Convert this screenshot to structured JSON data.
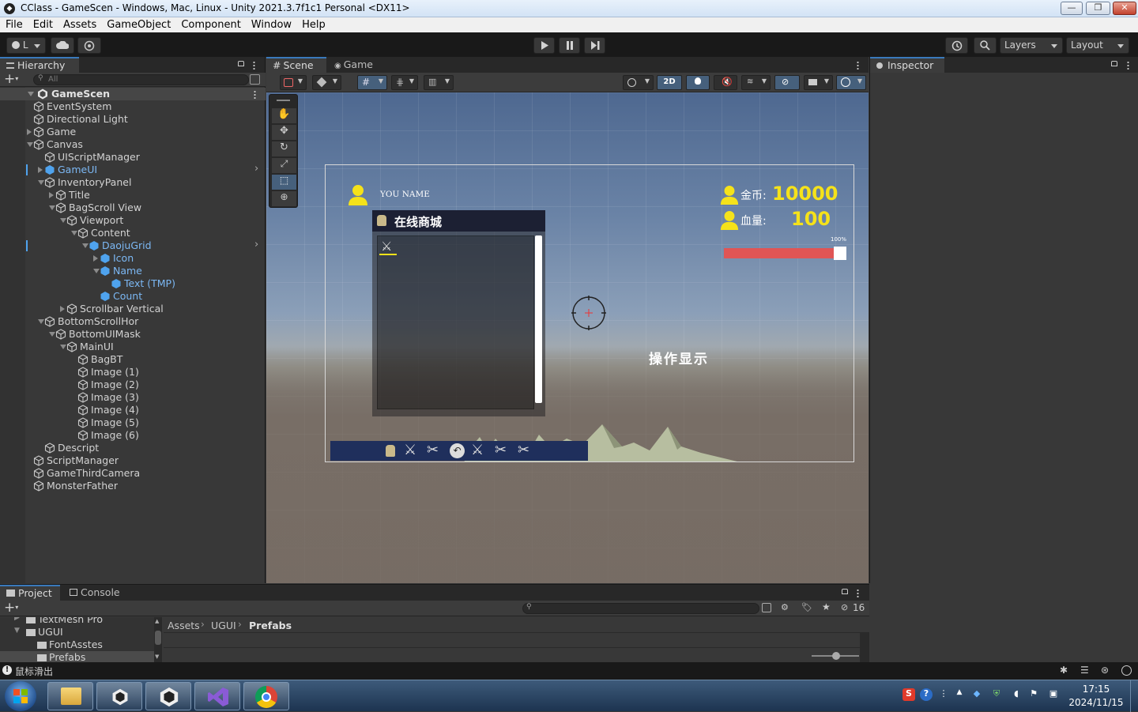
{
  "window": {
    "title": "CClass - GameScen - Windows, Mac, Linux - Unity 2021.3.7f1c1 Personal <DX11>",
    "controls": {
      "minimize": "—",
      "maximize": "❐",
      "close": "✕"
    }
  },
  "menu": [
    "File",
    "Edit",
    "Assets",
    "GameObject",
    "Component",
    "Window",
    "Help"
  ],
  "toolbar": {
    "account_label": "L",
    "layers_label": "Layers",
    "layout_label": "Layout"
  },
  "hierarchy": {
    "tab_label": "Hierarchy",
    "search_placeholder": "All",
    "scene_name": "GameScen",
    "rows": [
      {
        "label": "EventSystem",
        "depth": 1,
        "arrow": "none",
        "prefab": false
      },
      {
        "label": "Directional Light",
        "depth": 1,
        "arrow": "none",
        "prefab": false
      },
      {
        "label": "Game",
        "depth": 1,
        "arrow": "closed",
        "prefab": false
      },
      {
        "label": "Canvas",
        "depth": 1,
        "arrow": "open",
        "prefab": false
      },
      {
        "label": "UIScriptManager",
        "depth": 2,
        "arrow": "none",
        "prefab": false
      },
      {
        "label": "GameUI",
        "depth": 2,
        "arrow": "closed",
        "prefab": true,
        "more": true
      },
      {
        "label": "InventoryPanel",
        "depth": 2,
        "arrow": "open",
        "prefab": false
      },
      {
        "label": "Title",
        "depth": 3,
        "arrow": "closed",
        "prefab": false
      },
      {
        "label": "BagScroll View",
        "depth": 3,
        "arrow": "open",
        "prefab": false
      },
      {
        "label": "Viewport",
        "depth": 4,
        "arrow": "open",
        "prefab": false
      },
      {
        "label": "Content",
        "depth": 5,
        "arrow": "open",
        "prefab": false
      },
      {
        "label": "DaojuGrid",
        "depth": 6,
        "arrow": "open",
        "prefab": true,
        "more": true
      },
      {
        "label": "Icon",
        "depth": 7,
        "arrow": "closed",
        "prefab": true
      },
      {
        "label": "Name",
        "depth": 7,
        "arrow": "open",
        "prefab": true
      },
      {
        "label": "Text (TMP)",
        "depth": 8,
        "arrow": "none",
        "prefab": true
      },
      {
        "label": "Count",
        "depth": 7,
        "arrow": "none",
        "prefab": true
      },
      {
        "label": "Scrollbar Vertical",
        "depth": 4,
        "arrow": "closed",
        "prefab": false
      },
      {
        "label": "BottomScrollHor",
        "depth": 2,
        "arrow": "open",
        "prefab": false
      },
      {
        "label": "BottomUIMask",
        "depth": 3,
        "arrow": "open",
        "prefab": false
      },
      {
        "label": "MainUI",
        "depth": 4,
        "arrow": "open",
        "prefab": false
      },
      {
        "label": "BagBT",
        "depth": 5,
        "arrow": "none",
        "prefab": false
      },
      {
        "label": "Image (1)",
        "depth": 5,
        "arrow": "none",
        "prefab": false
      },
      {
        "label": "Image (2)",
        "depth": 5,
        "arrow": "none",
        "prefab": false
      },
      {
        "label": "Image (3)",
        "depth": 5,
        "arrow": "none",
        "prefab": false
      },
      {
        "label": "Image (4)",
        "depth": 5,
        "arrow": "none",
        "prefab": false
      },
      {
        "label": "Image (5)",
        "depth": 5,
        "arrow": "none",
        "prefab": false
      },
      {
        "label": "Image (6)",
        "depth": 5,
        "arrow": "none",
        "prefab": false
      },
      {
        "label": "Descript",
        "depth": 2,
        "arrow": "none",
        "prefab": false
      },
      {
        "label": "ScriptManager",
        "depth": 1,
        "arrow": "none",
        "prefab": false
      },
      {
        "label": "GameThirdCamera",
        "depth": 1,
        "arrow": "none",
        "prefab": false
      },
      {
        "label": "MonsterFather",
        "depth": 1,
        "arrow": "none",
        "prefab": false
      }
    ]
  },
  "scene": {
    "tabs": [
      "Scene",
      "Game"
    ],
    "mode_2d_label": "2D",
    "ui": {
      "player_name": "YOU NAME",
      "shop_title": "在线商城",
      "coin_label": "金币:",
      "coin_value": "10000",
      "hp_label": "血量:",
      "hp_value": "100",
      "hp_percent_label": "100%",
      "hp_fraction": 0.92,
      "operation_text": "操作显示"
    }
  },
  "inspector": {
    "tab_label": "Inspector"
  },
  "project": {
    "tabs": [
      "Project",
      "Console"
    ],
    "tree": [
      {
        "label": "TextMesh Pro",
        "depth": 1
      },
      {
        "label": "UGUI",
        "depth": 1
      },
      {
        "label": "FontAsstes",
        "depth": 2
      },
      {
        "label": "Prefabs",
        "depth": 2
      }
    ],
    "breadcrumb": [
      "Assets",
      "UGUI",
      "Prefabs"
    ],
    "hidden_count": "16"
  },
  "status": {
    "message": "鼠标滑出"
  },
  "taskbar": {
    "time": "17:15",
    "date": "2024/11/15"
  },
  "colors": {
    "accent": "#3a79bb",
    "prefab_text": "#7cb8f4",
    "hud_yellow": "#f5e21a",
    "hp_red": "#e05555"
  }
}
